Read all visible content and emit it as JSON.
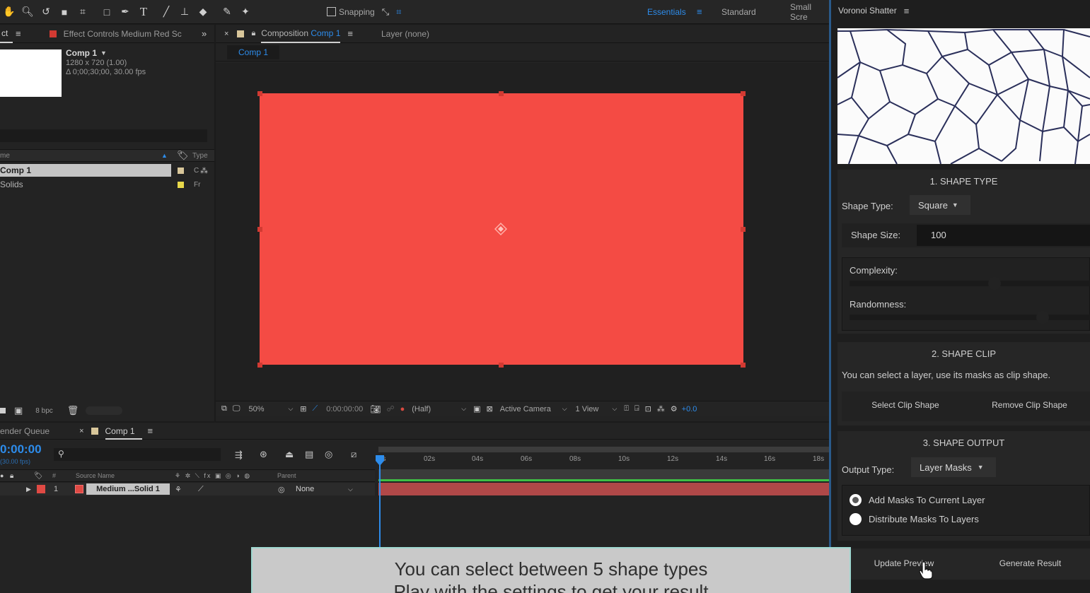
{
  "toolbar": {
    "snapping_label": "Snapping",
    "workspaces": [
      "Essentials",
      "Standard",
      "Small Scre"
    ],
    "tools": [
      "hand-tool-icon",
      "zoom-tool-icon",
      "rotate-tool-icon",
      "camera-tool-icon",
      "pan-behind-tool-icon",
      "rectangle-tool-icon",
      "pen-tool-icon",
      "type-tool-icon",
      "brush-tool-icon",
      "clone-stamp-tool-icon",
      "eraser-tool-icon",
      "roto-brush-tool-icon",
      "puppet-pin-tool-icon"
    ]
  },
  "project_panel": {
    "tab_label": "ct",
    "effect_tab_label": "Effect Controls Medium Red Sc",
    "comp_name": "Comp 1",
    "comp_size": "1280 x 720 (1.00)",
    "comp_duration": "Δ 0;00;30;00, 30.00 fps",
    "col_name": "me",
    "col_type": "Type",
    "items": [
      {
        "name": "Comp 1",
        "type": "C",
        "label_color": "#d8c69a"
      },
      {
        "name": "Solids",
        "type": "Fr",
        "label_color": "#e8d84a"
      }
    ],
    "bpc": "8 bpc"
  },
  "comp_panel": {
    "tab_prefix": "Composition",
    "tab_comp": "Comp 1",
    "layer_tab": "Layer (none)",
    "breadcrumb": "Comp 1",
    "solid_color": "#f44b44",
    "footer": {
      "zoom": "50%",
      "timecode": "0:00:00:00",
      "resolution": "(Half)",
      "camera": "Active Camera",
      "views": "1 View",
      "exposure": "+0.0"
    }
  },
  "timeline": {
    "render_queue_tab": "ender Queue",
    "comp_tab": "Comp 1",
    "timecode": "0:00:00",
    "fps": "(30.00 fps)",
    "col_number": "#",
    "col_source": "Source Name",
    "col_parent": "Parent",
    "ruler": [
      "0s",
      "02s",
      "04s",
      "06s",
      "08s",
      "10s",
      "12s",
      "14s",
      "16s",
      "18s"
    ],
    "layer": {
      "index": "1",
      "name": "Medium ...Solid 1",
      "parent": "None",
      "color": "#e04a44",
      "bar_color": "#b04848"
    }
  },
  "voronoi": {
    "title": "Voronoi Shatter",
    "section1_title": "1. SHAPE TYPE",
    "shape_type_label": "Shape Type:",
    "shape_type_value": "Square",
    "shape_size_label": "Shape Size:",
    "shape_size_value": "100",
    "complexity_label": "Complexity:",
    "complexity_value": 0.6,
    "randomness_label": "Randomness:",
    "randomness_value": 0.8,
    "section2_title": "2. SHAPE CLIP",
    "clip_help": "You can select a layer, use its masks as clip shape.",
    "select_clip_button": "Select Clip Shape",
    "remove_clip_button": "Remove Clip Shape",
    "section3_title": "3. SHAPE OUTPUT",
    "output_type_label": "Output Type:",
    "output_type_value": "Layer Masks",
    "radio_options": [
      "Add Masks To Current Layer",
      "Distribute Masks To Layers"
    ],
    "update_preview_button": "Update Preview",
    "generate_result_button": "Generate Result"
  },
  "caption": {
    "line1": "You can select between 5 shape types",
    "line2": "Play with the settings to get your result"
  }
}
